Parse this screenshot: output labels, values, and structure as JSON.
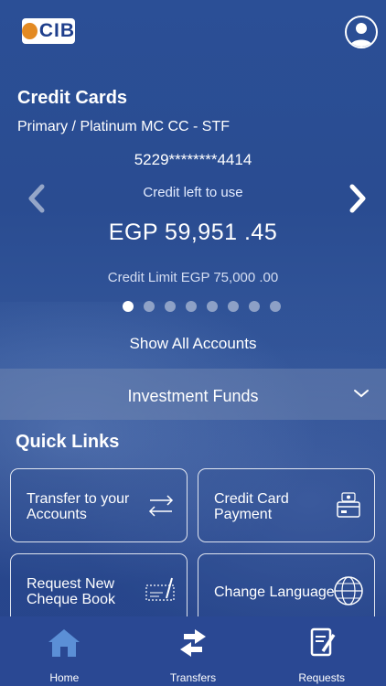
{
  "brand": {
    "logo_text": "CIB"
  },
  "accounts": {
    "section_title": "Credit Cards",
    "card_type": "Primary / Platinum MC CC - STF",
    "card_number": "5229********4414",
    "credit_left_label": "Credit left to use",
    "credit_left_amount": "EGP 59,951 .45",
    "credit_limit": "Credit Limit  EGP 75,000 .00",
    "pager": {
      "total": 8,
      "active_index": 0
    },
    "show_all_label": "Show All Accounts"
  },
  "investment": {
    "label": "Investment Funds"
  },
  "quick_links": {
    "title": "Quick Links",
    "items": [
      {
        "label": "Transfer to your Accounts",
        "icon": "transfer-arrows-icon"
      },
      {
        "label": "Credit Card Payment",
        "icon": "credit-card-payment-icon"
      },
      {
        "label": "Request New Cheque Book",
        "icon": "cheque-book-icon"
      },
      {
        "label": "Change Language",
        "icon": "globe-icon"
      }
    ]
  },
  "tabbar": {
    "items": [
      {
        "label": "Home",
        "icon": "home-icon"
      },
      {
        "label": "Transfers",
        "icon": "transfers-icon"
      },
      {
        "label": "Requests",
        "icon": "requests-icon"
      }
    ]
  },
  "colors": {
    "background": "#2b4f96",
    "tabbar": "#2a4893",
    "text": "#ffffff",
    "logo_orange": "#e38a22"
  }
}
